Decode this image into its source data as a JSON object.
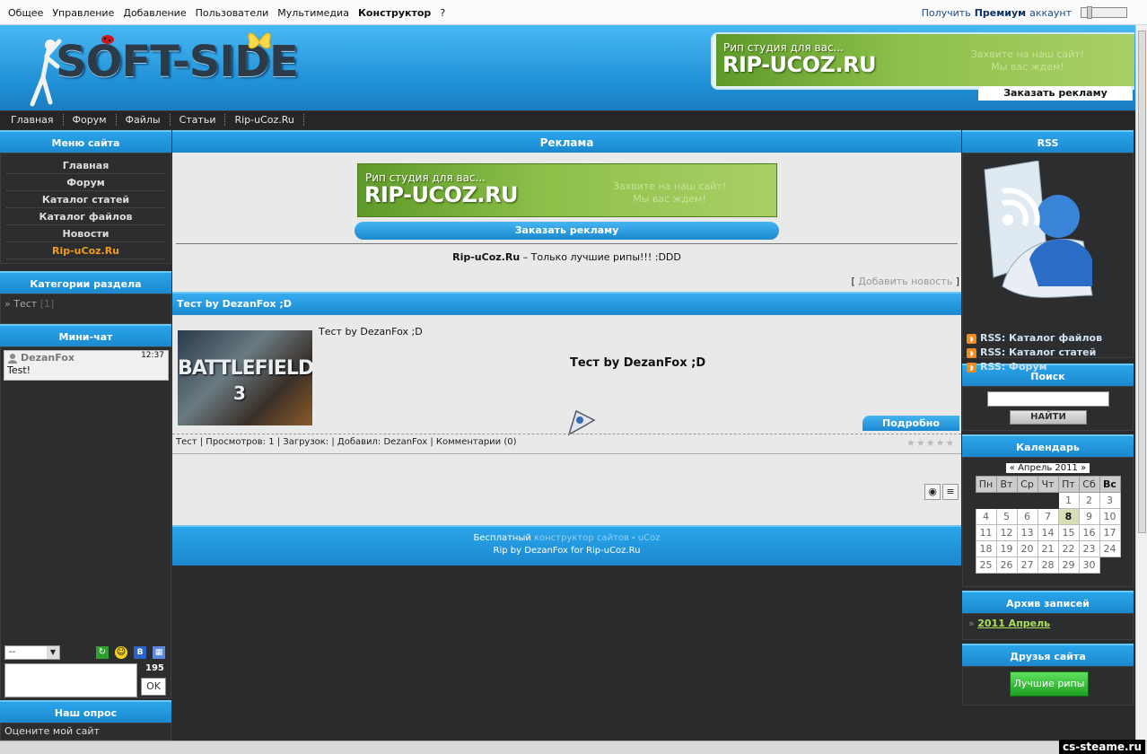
{
  "topbar": {
    "menu": [
      "Общее",
      "Управление",
      "Добавление",
      "Пользователи",
      "Мультимедиа",
      "Конструктор",
      "?"
    ],
    "premium_prefix": "Получить",
    "premium_bold": "Премиум",
    "premium_suffix": "аккаунт"
  },
  "header": {
    "logo_text": "SOFT-SIDE",
    "ad_small": "Рип студия для вас...",
    "ad_big": "RIP-UCOZ.RU",
    "ad_faint_1": "Захвите на наш сайт!",
    "ad_faint_2": "Мы вас ждем!",
    "order_ad": "Заказать рекламу"
  },
  "nav": [
    "Главная",
    "Форум",
    "Файлы",
    "Статьи",
    "Rip-uCoz.Ru"
  ],
  "left": {
    "menu_title": "Меню сайта",
    "menu_items": [
      "Главная",
      "Форум",
      "Каталог статей",
      "Каталог файлов",
      "Новости",
      "Rip-uCoz.Ru"
    ],
    "categories_title": "Категории раздела",
    "category_name": "Тест",
    "category_count": "[1]",
    "chat_title": "Мини-чат",
    "chat_user": "DezanFox",
    "chat_time": "12:37",
    "chat_text": "Test!",
    "chat_select": "--",
    "chat_counter": "195",
    "chat_ok": "OK",
    "poll_title": "Наш опрос",
    "poll_text": "Оцените мой сайт"
  },
  "center": {
    "ad_title": "Реклама",
    "order_ad": "Заказать рекламу",
    "tagline_bold": "Rip-uCoz.Ru",
    "tagline_rest": " – Только лучшие рипы!!! :DDD",
    "add_news": "Добавить новость",
    "post_title": "Тест by DezanFox ;D",
    "post_small": "Тест by DezanFox ;D",
    "post_big": "Тест by DezanFox ;D",
    "image_text": "BATTLEFIELD",
    "image_num": "3",
    "more_button": "Подробно",
    "post_meta": "Тест | Просмотров: 1 | Загрузок: | Добавил: DezanFox | Комментарии (0)",
    "footer_1a": "Бесплатный ",
    "footer_1b": "конструктор сайтов",
    "footer_1c": " - ",
    "footer_1d": "uCoz",
    "footer_2": "Rip by DezanFox for Rip-uCoz.Ru"
  },
  "right": {
    "rss_title": "RSS",
    "rss_links": [
      "RSS: Каталог файлов",
      "RSS: Каталог статей",
      "RSS: Форум"
    ],
    "search_title": "Поиск",
    "search_button": "НАЙТИ",
    "calendar_title": "Календарь",
    "calendar_month": "«   Апрель 2011   »",
    "weekdays": [
      "Пн",
      "Вт",
      "Ср",
      "Чт",
      "Пт",
      "Сб",
      "Вс"
    ],
    "weeks": [
      [
        "",
        "",
        "",
        "",
        "1",
        "2",
        "3"
      ],
      [
        "4",
        "5",
        "6",
        "7",
        "8",
        "9",
        "10"
      ],
      [
        "11",
        "12",
        "13",
        "14",
        "15",
        "16",
        "17"
      ],
      [
        "18",
        "19",
        "20",
        "21",
        "22",
        "23",
        "24"
      ],
      [
        "25",
        "26",
        "27",
        "28",
        "29",
        "30",
        ""
      ]
    ],
    "archive_title": "Архив записей",
    "archive_link": "2011 Апрель",
    "friends_title": "Друзья сайта",
    "friends_button": "Лучшие рипы"
  },
  "watermark": "cs-steame.ru",
  "colors": {
    "accent_blue": "#1b88cf",
    "orange": "#f39b1b",
    "green": "#3fbf3f"
  }
}
